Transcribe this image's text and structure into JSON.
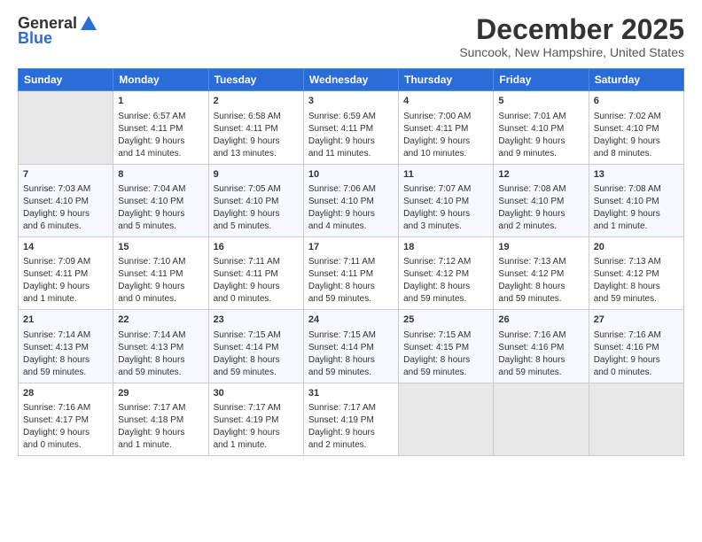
{
  "logo": {
    "general": "General",
    "blue": "Blue"
  },
  "title": "December 2025",
  "subtitle": "Suncook, New Hampshire, United States",
  "header_days": [
    "Sunday",
    "Monday",
    "Tuesday",
    "Wednesday",
    "Thursday",
    "Friday",
    "Saturday"
  ],
  "weeks": [
    [
      {
        "day": "",
        "content": ""
      },
      {
        "day": "1",
        "content": "Sunrise: 6:57 AM\nSunset: 4:11 PM\nDaylight: 9 hours\nand 14 minutes."
      },
      {
        "day": "2",
        "content": "Sunrise: 6:58 AM\nSunset: 4:11 PM\nDaylight: 9 hours\nand 13 minutes."
      },
      {
        "day": "3",
        "content": "Sunrise: 6:59 AM\nSunset: 4:11 PM\nDaylight: 9 hours\nand 11 minutes."
      },
      {
        "day": "4",
        "content": "Sunrise: 7:00 AM\nSunset: 4:11 PM\nDaylight: 9 hours\nand 10 minutes."
      },
      {
        "day": "5",
        "content": "Sunrise: 7:01 AM\nSunset: 4:10 PM\nDaylight: 9 hours\nand 9 minutes."
      },
      {
        "day": "6",
        "content": "Sunrise: 7:02 AM\nSunset: 4:10 PM\nDaylight: 9 hours\nand 8 minutes."
      }
    ],
    [
      {
        "day": "7",
        "content": "Sunrise: 7:03 AM\nSunset: 4:10 PM\nDaylight: 9 hours\nand 6 minutes."
      },
      {
        "day": "8",
        "content": "Sunrise: 7:04 AM\nSunset: 4:10 PM\nDaylight: 9 hours\nand 5 minutes."
      },
      {
        "day": "9",
        "content": "Sunrise: 7:05 AM\nSunset: 4:10 PM\nDaylight: 9 hours\nand 5 minutes."
      },
      {
        "day": "10",
        "content": "Sunrise: 7:06 AM\nSunset: 4:10 PM\nDaylight: 9 hours\nand 4 minutes."
      },
      {
        "day": "11",
        "content": "Sunrise: 7:07 AM\nSunset: 4:10 PM\nDaylight: 9 hours\nand 3 minutes."
      },
      {
        "day": "12",
        "content": "Sunrise: 7:08 AM\nSunset: 4:10 PM\nDaylight: 9 hours\nand 2 minutes."
      },
      {
        "day": "13",
        "content": "Sunrise: 7:08 AM\nSunset: 4:10 PM\nDaylight: 9 hours\nand 1 minute."
      }
    ],
    [
      {
        "day": "14",
        "content": "Sunrise: 7:09 AM\nSunset: 4:11 PM\nDaylight: 9 hours\nand 1 minute."
      },
      {
        "day": "15",
        "content": "Sunrise: 7:10 AM\nSunset: 4:11 PM\nDaylight: 9 hours\nand 0 minutes."
      },
      {
        "day": "16",
        "content": "Sunrise: 7:11 AM\nSunset: 4:11 PM\nDaylight: 9 hours\nand 0 minutes."
      },
      {
        "day": "17",
        "content": "Sunrise: 7:11 AM\nSunset: 4:11 PM\nDaylight: 8 hours\nand 59 minutes."
      },
      {
        "day": "18",
        "content": "Sunrise: 7:12 AM\nSunset: 4:12 PM\nDaylight: 8 hours\nand 59 minutes."
      },
      {
        "day": "19",
        "content": "Sunrise: 7:13 AM\nSunset: 4:12 PM\nDaylight: 8 hours\nand 59 minutes."
      },
      {
        "day": "20",
        "content": "Sunrise: 7:13 AM\nSunset: 4:12 PM\nDaylight: 8 hours\nand 59 minutes."
      }
    ],
    [
      {
        "day": "21",
        "content": "Sunrise: 7:14 AM\nSunset: 4:13 PM\nDaylight: 8 hours\nand 59 minutes."
      },
      {
        "day": "22",
        "content": "Sunrise: 7:14 AM\nSunset: 4:13 PM\nDaylight: 8 hours\nand 59 minutes."
      },
      {
        "day": "23",
        "content": "Sunrise: 7:15 AM\nSunset: 4:14 PM\nDaylight: 8 hours\nand 59 minutes."
      },
      {
        "day": "24",
        "content": "Sunrise: 7:15 AM\nSunset: 4:14 PM\nDaylight: 8 hours\nand 59 minutes."
      },
      {
        "day": "25",
        "content": "Sunrise: 7:15 AM\nSunset: 4:15 PM\nDaylight: 8 hours\nand 59 minutes."
      },
      {
        "day": "26",
        "content": "Sunrise: 7:16 AM\nSunset: 4:16 PM\nDaylight: 8 hours\nand 59 minutes."
      },
      {
        "day": "27",
        "content": "Sunrise: 7:16 AM\nSunset: 4:16 PM\nDaylight: 9 hours\nand 0 minutes."
      }
    ],
    [
      {
        "day": "28",
        "content": "Sunrise: 7:16 AM\nSunset: 4:17 PM\nDaylight: 9 hours\nand 0 minutes."
      },
      {
        "day": "29",
        "content": "Sunrise: 7:17 AM\nSunset: 4:18 PM\nDaylight: 9 hours\nand 1 minute."
      },
      {
        "day": "30",
        "content": "Sunrise: 7:17 AM\nSunset: 4:19 PM\nDaylight: 9 hours\nand 1 minute."
      },
      {
        "day": "31",
        "content": "Sunrise: 7:17 AM\nSunset: 4:19 PM\nDaylight: 9 hours\nand 2 minutes."
      },
      {
        "day": "",
        "content": ""
      },
      {
        "day": "",
        "content": ""
      },
      {
        "day": "",
        "content": ""
      }
    ]
  ]
}
